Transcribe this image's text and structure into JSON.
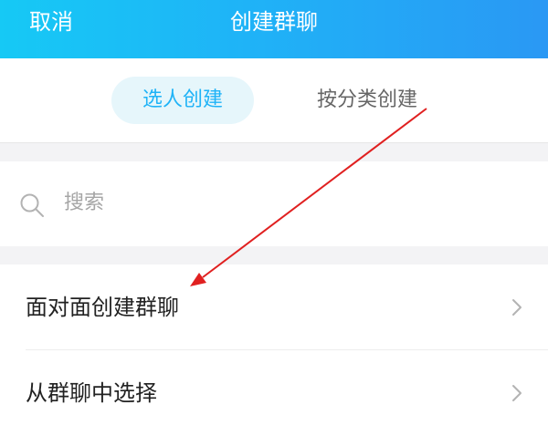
{
  "header": {
    "cancel_label": "取消",
    "title": "创建群聊"
  },
  "tabs": [
    {
      "label": "选人创建",
      "active": true
    },
    {
      "label": "按分类创建",
      "active": false
    }
  ],
  "search": {
    "placeholder": "搜索",
    "icon": "search-icon"
  },
  "list": [
    {
      "label": "面对面创建群聊",
      "icon": "chevron-right-icon"
    },
    {
      "label": "从群聊中选择",
      "icon": "chevron-right-icon"
    }
  ],
  "colors": {
    "header_gradient_start": "#16c9f5",
    "header_gradient_end": "#2a98f4",
    "tab_active_bg": "#e6f6fb",
    "tab_active_text": "#1fb3f7",
    "annotation_arrow": "#e02020"
  }
}
